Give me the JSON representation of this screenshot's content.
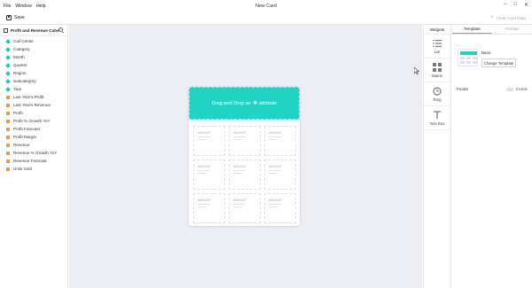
{
  "menu": [
    "File",
    "Window",
    "Help"
  ],
  "window": {
    "title": "New Card"
  },
  "toolbar": {
    "save_label": "Save",
    "clear_label": "Clear Card Data"
  },
  "sidebar": {
    "cube_name": "Profit and Revenue Cube",
    "items": [
      {
        "label": "Call Center",
        "type": "dimension"
      },
      {
        "label": "Category",
        "type": "dimension"
      },
      {
        "label": "Month",
        "type": "dimension"
      },
      {
        "label": "Quarter",
        "type": "dimension"
      },
      {
        "label": "Region",
        "type": "dimension"
      },
      {
        "label": "Subcategory",
        "type": "dimension"
      },
      {
        "label": "Year",
        "type": "dimension"
      },
      {
        "label": "Last Year's Profit",
        "type": "measure"
      },
      {
        "label": "Last Year's Revenue",
        "type": "measure"
      },
      {
        "label": "Profit",
        "type": "measure"
      },
      {
        "label": "Profit % Growth YoY",
        "type": "measure"
      },
      {
        "label": "Profit Forecast",
        "type": "measure"
      },
      {
        "label": "Profit Margin",
        "type": "measure"
      },
      {
        "label": "Revenue",
        "type": "measure"
      },
      {
        "label": "Revenue % Growth YoY",
        "type": "measure"
      },
      {
        "label": "Revenue Forecast",
        "type": "measure"
      },
      {
        "label": "Units Sold",
        "type": "measure"
      }
    ]
  },
  "card": {
    "drop_text_before": "Drag and Drop an",
    "drop_text_after": "attribute",
    "tiles": [
      "AMOUNT",
      "AMOUNT",
      "AMOUNT",
      "AMOUNT",
      "AMOUNT",
      "AMOUNT",
      "AMOUNT",
      "AMOUNT",
      "AMOUNT"
    ]
  },
  "widgets": {
    "title": "Widgets",
    "items": [
      "List",
      "Matrix",
      "Ring",
      "Text Box"
    ]
  },
  "panel": {
    "tabs": [
      "Template",
      "Format"
    ],
    "template_name": "Basic",
    "change_label": "Change Template",
    "footer_label": "Footer",
    "enable_label": "Enable"
  },
  "colors": {
    "accent": "#21d3c2",
    "dimension": "#23c6b7",
    "measure": "#d7a14f"
  }
}
